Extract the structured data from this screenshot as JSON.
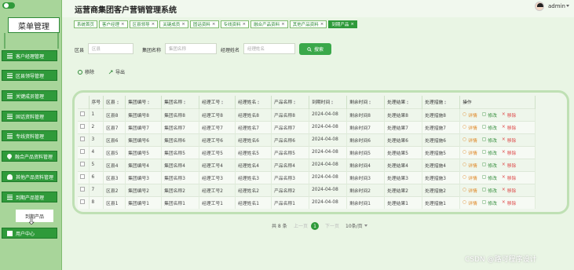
{
  "app": {
    "title": "运营商集团客户营销管理系统",
    "user": "admin"
  },
  "sidebar": {
    "title": "菜单管理",
    "items": [
      {
        "label": "客户经理管理",
        "icon": "list-icon"
      },
      {
        "label": "区县领导管理",
        "icon": "list-icon"
      },
      {
        "label": "关键成员管理",
        "icon": "list-icon"
      },
      {
        "label": "固话资料管理",
        "icon": "list-icon"
      },
      {
        "label": "专线资料管理",
        "icon": "list-icon"
      },
      {
        "label": "融合产品资料管理",
        "icon": "pin-icon"
      },
      {
        "label": "其他产品资料管理",
        "icon": "user-icon"
      },
      {
        "label": "到期产品管理",
        "icon": "list-icon"
      }
    ],
    "sub_item": "到期产品",
    "footer": "用户中心"
  },
  "tabs": [
    {
      "label": "系统首页",
      "closable": false,
      "active": false
    },
    {
      "label": "客户经理",
      "closable": true,
      "active": false
    },
    {
      "label": "区县领导",
      "closable": true,
      "active": false
    },
    {
      "label": "关键成员",
      "closable": true,
      "active": false
    },
    {
      "label": "固话资料",
      "closable": true,
      "active": false
    },
    {
      "label": "专线资料",
      "closable": true,
      "active": false
    },
    {
      "label": "融合产品资料",
      "closable": true,
      "active": false
    },
    {
      "label": "其他产品资料",
      "closable": true,
      "active": false
    },
    {
      "label": "到期产品",
      "closable": true,
      "active": true
    }
  ],
  "search": {
    "fields": [
      {
        "label": "区县",
        "placeholder": "区县"
      },
      {
        "label": "集团名称",
        "placeholder": "集团名称"
      },
      {
        "label": "经理姓名",
        "placeholder": "经理姓名"
      }
    ],
    "button": "搜索"
  },
  "actions": {
    "delete": "移除",
    "export": "导出"
  },
  "table": {
    "headers": [
      "序号",
      "区县",
      "集团编号",
      "集团名称",
      "经理工号",
      "经理姓名",
      "产品名称",
      "到期时间",
      "剩余时间",
      "处理结果",
      "处理措施",
      "操作"
    ],
    "rows": [
      [
        "1",
        "区县8",
        "集团编号8",
        "集团名称8",
        "经理工号8",
        "经理姓名8",
        "产品名称8",
        "2024-04-08",
        "剩余时间8",
        "处理结果8",
        "处理措施8"
      ],
      [
        "2",
        "区县7",
        "集团编号7",
        "集团名称7",
        "经理工号7",
        "经理姓名7",
        "产品名称7",
        "2024-04-08",
        "剩余时间7",
        "处理结果7",
        "处理措施7"
      ],
      [
        "3",
        "区县6",
        "集团编号6",
        "集团名称6",
        "经理工号6",
        "经理姓名6",
        "产品名称6",
        "2024-04-08",
        "剩余时间6",
        "处理结果6",
        "处理措施6"
      ],
      [
        "4",
        "区县5",
        "集团编号5",
        "集团名称5",
        "经理工号5",
        "经理姓名5",
        "产品名称5",
        "2024-04-08",
        "剩余时间5",
        "处理结果5",
        "处理措施5"
      ],
      [
        "5",
        "区县4",
        "集团编号4",
        "集团名称4",
        "经理工号4",
        "经理姓名4",
        "产品名称4",
        "2024-04-08",
        "剩余时间4",
        "处理结果4",
        "处理措施4"
      ],
      [
        "6",
        "区县3",
        "集团编号3",
        "集团名称3",
        "经理工号3",
        "经理姓名3",
        "产品名称3",
        "2024-04-08",
        "剩余时间3",
        "处理结果3",
        "处理措施3"
      ],
      [
        "7",
        "区县2",
        "集团编号2",
        "集团名称2",
        "经理工号2",
        "经理姓名2",
        "产品名称2",
        "2024-04-08",
        "剩余时间2",
        "处理结果2",
        "处理措施2"
      ],
      [
        "8",
        "区县1",
        "集团编号1",
        "集团名称1",
        "经理工号1",
        "经理姓名1",
        "产品名称1",
        "2024-04-08",
        "剩余时间1",
        "处理结果1",
        "处理措施1"
      ]
    ],
    "row_actions": {
      "view": "详情",
      "edit": "修改",
      "delete": "移除"
    }
  },
  "pagination": {
    "total": "共 8 条",
    "prev": "上一页",
    "current": "1",
    "next": "下一页",
    "page_size": "10条/页"
  },
  "watermark": "CSDN @路可程序设计",
  "colors": {
    "primary": "#2f9a3a",
    "sidebar_bg": "#a8d59a",
    "page_bg": "#e9f5e4"
  }
}
